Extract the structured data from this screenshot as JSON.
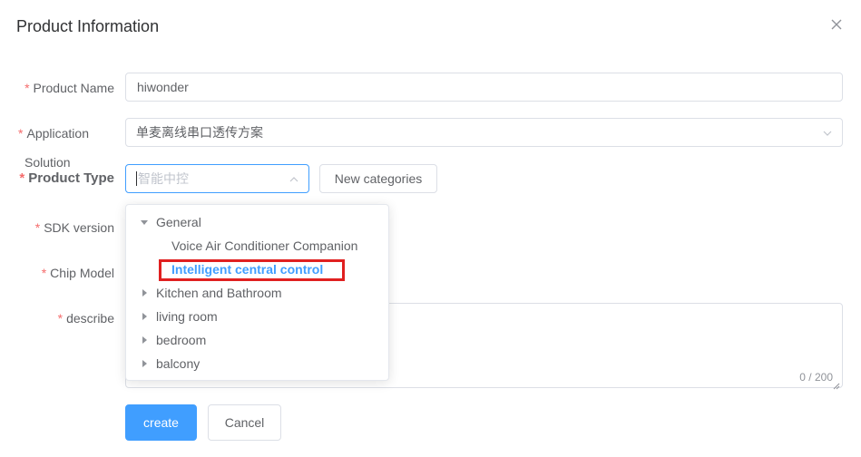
{
  "dialog": {
    "title": "Product Information"
  },
  "form": {
    "product_name": {
      "label": "Product Name",
      "value": "hiwonder"
    },
    "application": {
      "label": "Application",
      "value": "单麦离线串口透传方案"
    },
    "solution_label": "Solution",
    "product_type": {
      "label": "Product Type",
      "placeholder": "智能中控",
      "new_categories_label": "New categories"
    },
    "sdk_version": {
      "label": "SDK version"
    },
    "chip_model": {
      "label": "Chip Model"
    },
    "describe": {
      "label": "describe",
      "counter": "0 / 200"
    },
    "required_mark": "*"
  },
  "dropdown": {
    "nodes": [
      {
        "label": "General",
        "expanded": true,
        "children": [
          {
            "label": "Voice Air Conditioner Companion"
          },
          {
            "label": "Intelligent central control",
            "selected": true
          }
        ]
      },
      {
        "label": "Kitchen and Bathroom"
      },
      {
        "label": "living room"
      },
      {
        "label": "bedroom"
      },
      {
        "label": "balcony"
      }
    ]
  },
  "actions": {
    "create_label": "create",
    "cancel_label": "Cancel"
  },
  "colors": {
    "primary": "#409eff",
    "required": "#f56c6c",
    "highlight": "#e02020"
  }
}
